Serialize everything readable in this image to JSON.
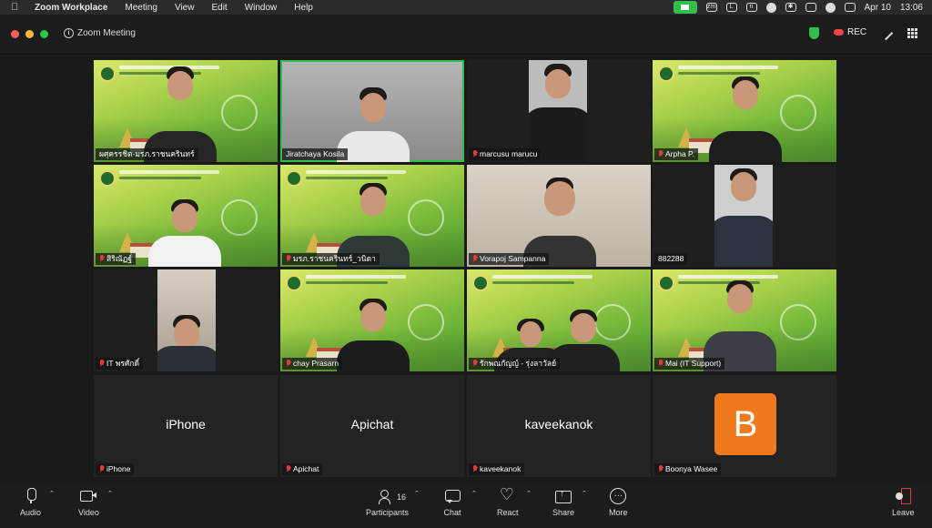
{
  "menubar": {
    "app_name": "Zoom Workplace",
    "items": [
      "Meeting",
      "View",
      "Edit",
      "Window",
      "Help"
    ],
    "date": "Apr 10",
    "time": "13:06"
  },
  "titlebar": {
    "title": "Zoom Meeting",
    "rec_label": "REC"
  },
  "tiles": [
    {
      "name": "ผศุครรชิต-มรภ.ราชนครินทร์",
      "muted": false
    },
    {
      "name": "Jiratchaya Kosila",
      "muted": false
    },
    {
      "name": "marcusu marucu",
      "muted": true
    },
    {
      "name": "Arpha P.",
      "muted": true
    },
    {
      "name": "สิริณัฏฐ์",
      "muted": true
    },
    {
      "name": "มรภ.ราชนครินทร์_วนิดา",
      "muted": true
    },
    {
      "name": "Vorapoj Sampanna",
      "muted": true
    },
    {
      "name": "882288",
      "muted": false
    },
    {
      "name": "IT พรศักดิ์",
      "muted": true
    },
    {
      "name": "chay Prasarn",
      "muted": true
    },
    {
      "name": "รักพณกัญญ์ - รุ่งลาวัลย์",
      "muted": true
    },
    {
      "name": "Mai (IT Support)",
      "muted": true
    },
    {
      "name": "iPhone",
      "display": "iPhone",
      "muted": true
    },
    {
      "name": "Apichat",
      "display": "Apichat",
      "muted": true
    },
    {
      "name": "kaveekanok",
      "display": "kaveekanok",
      "muted": true
    },
    {
      "name": "Boonya Wasee",
      "initial": "B",
      "muted": true
    }
  ],
  "toolbar": {
    "audio_label": "Audio",
    "video_label": "Video",
    "participants_label": "Participants",
    "participants_count": "16",
    "chat_label": "Chat",
    "react_label": "React",
    "share_label": "Share",
    "more_label": "More",
    "leave_label": "Leave"
  },
  "colors": {
    "accent_green": "#2fbf4a",
    "muted_red": "#e03b3b",
    "avatar_orange": "#f0791e"
  }
}
